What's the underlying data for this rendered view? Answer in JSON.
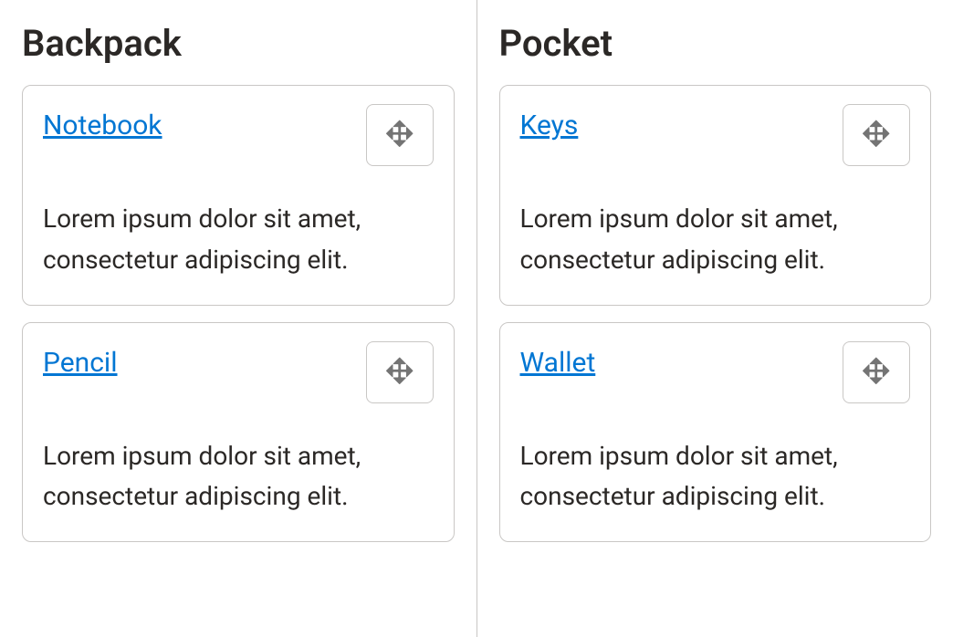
{
  "columns": [
    {
      "title": "Backpack",
      "cards": [
        {
          "title": "Notebook",
          "body": "Lorem ipsum dolor sit amet, consectetur adipiscing elit."
        },
        {
          "title": "Pencil",
          "body": "Lorem ipsum dolor sit amet, consectetur adipiscing elit."
        }
      ]
    },
    {
      "title": "Pocket",
      "cards": [
        {
          "title": "Keys",
          "body": "Lorem ipsum dolor sit amet, consectetur adipiscing elit."
        },
        {
          "title": "Wallet",
          "body": "Lorem ipsum dolor sit amet, consectetur adipiscing elit."
        }
      ]
    }
  ]
}
